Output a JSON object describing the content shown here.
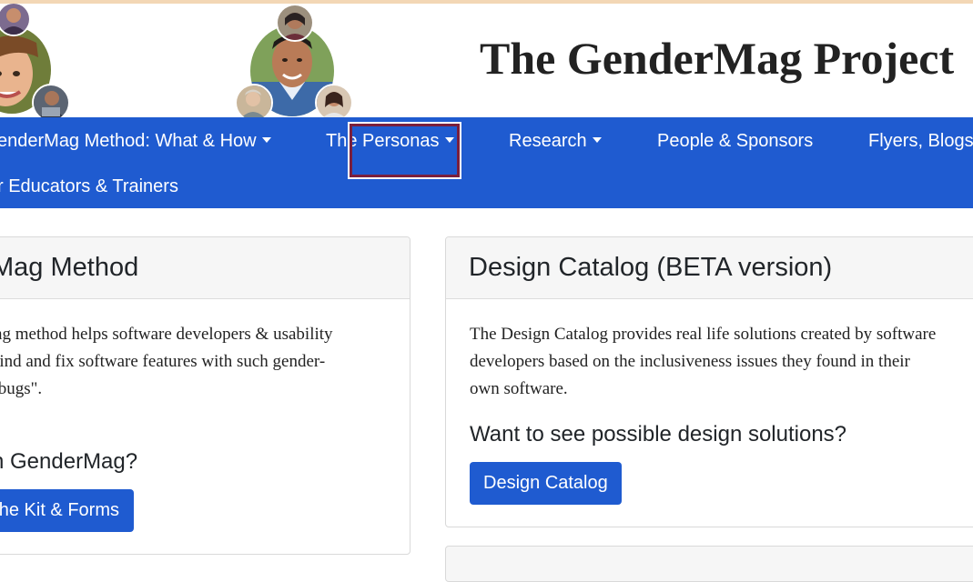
{
  "site": {
    "title": "The GenderMag Project"
  },
  "nav": {
    "items": [
      {
        "label": "enderMag Method: What & How",
        "has_dropdown": true
      },
      {
        "label": "The Personas",
        "has_dropdown": true,
        "focused": true
      },
      {
        "label": "Research",
        "has_dropdown": true
      },
      {
        "label": "People & Sponsors",
        "has_dropdown": false
      },
      {
        "label": "Flyers, Blogs",
        "has_dropdown": false
      },
      {
        "label": "r Educators & Trainers",
        "has_dropdown": false
      }
    ]
  },
  "left_card": {
    "title": "Mag Method",
    "text_lines": [
      "ng method helps software developers & usability",
      "find and fix software features with such gender-",
      " bugs\"."
    ],
    "question": "n GenderMag?",
    "button_label": "he Kit & Forms"
  },
  "right_card": {
    "title": "Design Catalog (BETA version)",
    "text_lines": [
      "The Design Catalog provides real life solutions created by software",
      "developers based on the inclusiveness issues they found in their",
      "own software."
    ],
    "question": "Want to see possible design solutions?",
    "button_label": "Design Catalog"
  },
  "colors": {
    "navbar": "#1f5bd0",
    "button": "#1f5bd0",
    "focus_outline": "#7a1f3d",
    "title_text": "#222222"
  },
  "icons": {
    "caret": "caret-down-icon"
  }
}
